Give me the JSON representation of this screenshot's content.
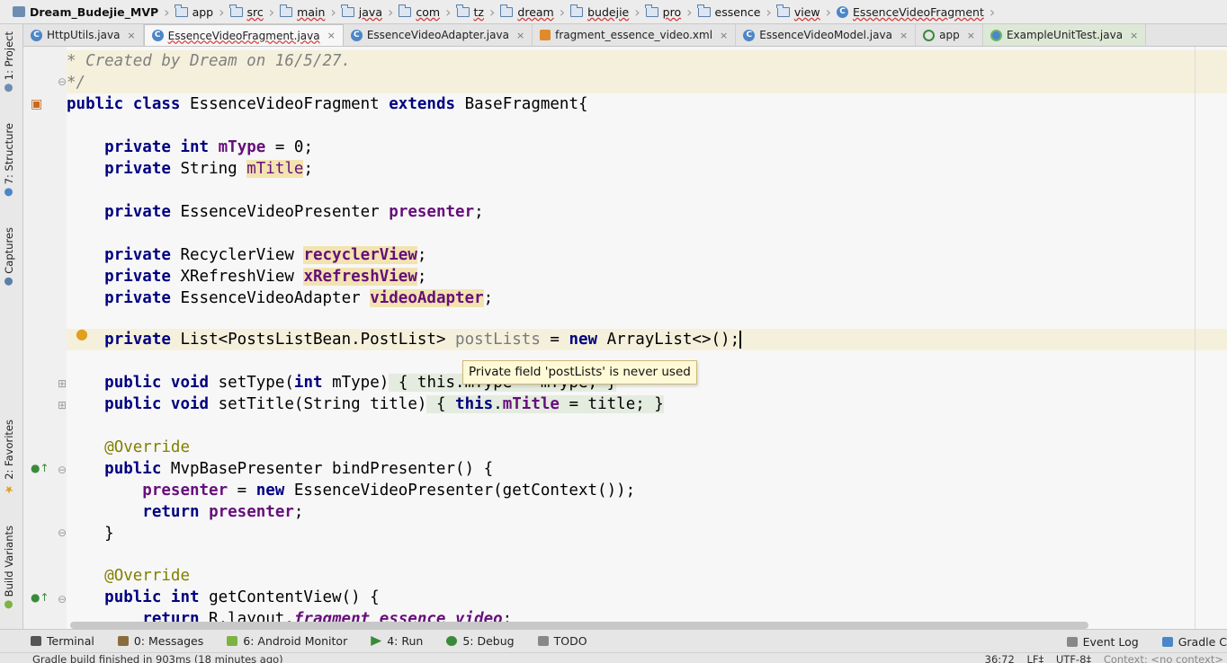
{
  "breadcrumb": [
    "Dream_Budejie_MVP",
    "app",
    "src",
    "main",
    "java",
    "com",
    "tz",
    "dream",
    "budejie",
    "pro",
    "essence",
    "view",
    "EssenceVideoFragment"
  ],
  "tabs": [
    {
      "label": "HttpUtils.java",
      "icon": "class-icon"
    },
    {
      "label": "EssenceVideoFragment.java",
      "icon": "class-icon",
      "active": true
    },
    {
      "label": "EssenceVideoAdapter.java",
      "icon": "class-icon"
    },
    {
      "label": "fragment_essence_video.xml",
      "icon": "xml-icon"
    },
    {
      "label": "EssenceVideoModel.java",
      "icon": "class-icon"
    },
    {
      "label": "app",
      "icon": "android-app-icon"
    },
    {
      "label": "ExampleUnitTest.java",
      "icon": "test-class-icon"
    }
  ],
  "tab_close_glyph": "×",
  "left_tools": [
    "1: Project",
    "7: Structure",
    "Captures",
    "2: Favorites",
    "Build Variants"
  ],
  "code": {
    "l1": "* Created by Dream on 16/5/27.",
    "l2": "*/",
    "class_decl": {
      "kw1": "public",
      "kw2": "class",
      "name": "EssenceVideoFragment",
      "kw3": "extends",
      "parent": "BaseFragment{"
    },
    "f1": {
      "mod": "private",
      "type": "int",
      "name": "mType",
      "rest": " = 0;"
    },
    "f2": {
      "mod": "private",
      "type": "String",
      "name": "mTitle",
      "rest": ";"
    },
    "f3": {
      "mod": "private",
      "type": "EssenceVideoPresenter",
      "name": "presenter",
      "rest": ";"
    },
    "f4": {
      "mod": "private",
      "type": "RecyclerView",
      "name": "recyclerView",
      "rest": ";"
    },
    "f5": {
      "mod": "private",
      "type": "XRefreshView",
      "name": "xRefreshView",
      "rest": ";"
    },
    "f6": {
      "mod": "private",
      "type": "EssenceVideoAdapter",
      "name": "videoAdapter",
      "rest": ";"
    },
    "f7": {
      "mod": "private",
      "type": "List<PostsListBean.PostList>",
      "name": "postLists",
      "eq": " = ",
      "kwnew": "new",
      "rest": " ArrayList<>();"
    },
    "m1": {
      "kw1": "public",
      "kw2": "void",
      "name": "setType(",
      "ptype": "int",
      "pname": " mType)",
      "body": " { this.mType = mType; }"
    },
    "m2": {
      "kw1": "public",
      "kw2": "void",
      "name": "setTitle(String title)",
      "b1": " { ",
      "kwthis": "this",
      "dot": ".",
      "fname": "mTitle",
      "b2": " = title; }"
    },
    "ann1": "@Override",
    "m3": {
      "kw1": "public",
      "type": "MvpBasePresenter",
      "rest": " bindPresenter() {"
    },
    "m3b1": {
      "fname": "presenter",
      "eq": " = ",
      "kwnew": "new",
      "rest": " EssenceVideoPresenter(getContext());"
    },
    "m3b2": {
      "kwret": "return",
      "fname": "presenter",
      "rest": ";"
    },
    "close": "}",
    "ann2": "@Override",
    "m4": {
      "kw1": "public",
      "kw2": "int",
      "rest": " getContentView() {"
    },
    "m4b1": {
      "kwret": "return",
      "rest": " R.layout.",
      "sfld": "fragment_essence_video",
      "end": ";"
    }
  },
  "tooltip": "Private field 'postLists' is never used",
  "bottom_tools": [
    {
      "label": "Terminal",
      "icon": "terminal-icon"
    },
    {
      "label": "0: Messages",
      "icon": "messages-icon"
    },
    {
      "label": "6: Android Monitor",
      "icon": "android-icon"
    },
    {
      "label": "4: Run",
      "icon": "run-icon"
    },
    {
      "label": "5: Debug",
      "icon": "debug-icon"
    },
    {
      "label": "TODO",
      "icon": "todo-icon"
    }
  ],
  "right_tools": [
    "Event Log",
    "Gradle C"
  ],
  "status": {
    "message": "Gradle build finished in 903ms (18 minutes ago)",
    "position": "36:72",
    "line_sep": "LF‡",
    "encoding": "UTF-8‡",
    "context": "Context: <no context>"
  },
  "colors": {
    "keyword": "#000080",
    "field": "#660e7a",
    "annotation": "#808000",
    "comment": "#808080",
    "tooltip_bg": "#fff9d6"
  }
}
